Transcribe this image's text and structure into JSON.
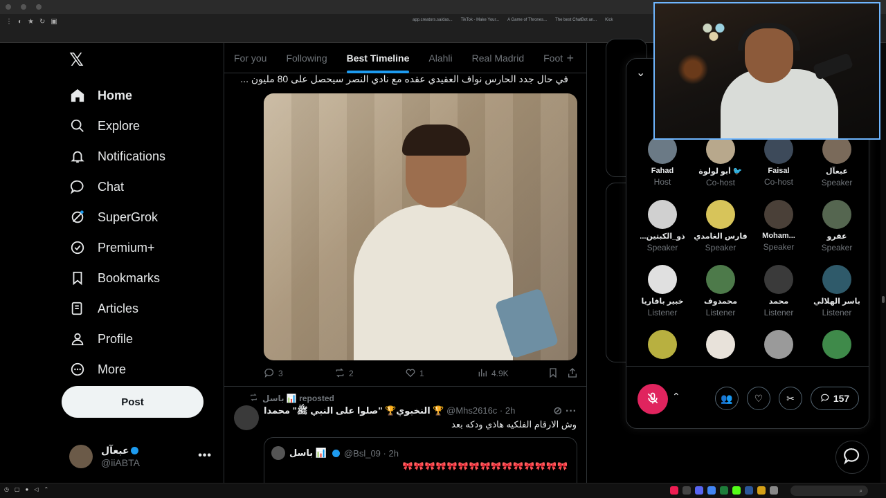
{
  "browser": {
    "bookmarks": [
      "app.creators.sa/das...",
      "TikTok - Make Your...",
      "A Game of Thrones...",
      "The best ChatBot an...",
      "Kick"
    ]
  },
  "sidebar": {
    "items": [
      {
        "label": "Home",
        "icon": "home-icon"
      },
      {
        "label": "Explore",
        "icon": "search-icon"
      },
      {
        "label": "Notifications",
        "icon": "bell-icon"
      },
      {
        "label": "Chat",
        "icon": "chat-bubble-icon"
      },
      {
        "label": "SuperGrok",
        "icon": "grok-icon"
      },
      {
        "label": "Premium+",
        "icon": "verified-icon"
      },
      {
        "label": "Bookmarks",
        "icon": "bookmark-icon"
      },
      {
        "label": "Articles",
        "icon": "article-icon"
      },
      {
        "label": "Profile",
        "icon": "person-icon"
      },
      {
        "label": "More",
        "icon": "more-circle-icon"
      }
    ],
    "post_label": "Post",
    "account": {
      "name": "عبعآل",
      "handle": "@iiABTA"
    }
  },
  "main": {
    "tabs": [
      "For you",
      "Following",
      "Best Timeline",
      "Alahli",
      "Real Madrid",
      "Foot"
    ],
    "active_tab": "Best Timeline",
    "tweet1": {
      "text": "في حال جدد الحارس نواف العقيدي عقده مع نادي النصر سيحصل على 80 مليون ...",
      "replies": "3",
      "reposts": "2",
      "likes": "1",
      "views": "4.9K"
    },
    "tweet2": {
      "repost_label": "باسل 📊 reposted",
      "display_name": "النخبوي🏆 \"صلوا على النبي ﷺ\" محمدا 🏆",
      "handle_time": "@Mhs2616c · 2h",
      "text": "وش الارقام الفلكيه هاذي ودكه بعد",
      "quote": {
        "name": "باسل 📊",
        "handle_time": "@Bsl_09 · 2h",
        "flags": "🎀🎀🎀🎀🎀🎀🎀🎀🎀🎀🎀🎀🎀🎀🎀"
      }
    }
  },
  "spaces": {
    "people": [
      {
        "name": "Fahad",
        "role": "Host"
      },
      {
        "name": "أبو لولوة 🐦",
        "role": "Co-host"
      },
      {
        "name": "Faisal",
        "role": "Co-host"
      },
      {
        "name": "عبعآل",
        "role": "Speaker"
      },
      {
        "name": "...ذو_الكبتين",
        "role": "Speaker"
      },
      {
        "name": "فارس الغامدي",
        "role": "Speaker"
      },
      {
        "name": "Moham...",
        "role": "Speaker"
      },
      {
        "name": "عفرو",
        "role": "Speaker"
      },
      {
        "name": "خبير بافاريا",
        "role": "Listener"
      },
      {
        "name": "محمدوف",
        "role": "Listener"
      },
      {
        "name": "محمد",
        "role": "Listener"
      },
      {
        "name": "باسر الهلالي",
        "role": "Listener"
      },
      {
        "name": "",
        "role": ""
      },
      {
        "name": "",
        "role": ""
      },
      {
        "name": "",
        "role": ""
      },
      {
        "name": "",
        "role": ""
      }
    ],
    "listener_count": "157"
  },
  "colors": {
    "accent": "#1d9bf0",
    "mic_red": "#e0245e",
    "background": "#000000",
    "text": "#e7e9ea",
    "muted": "#71767b"
  }
}
